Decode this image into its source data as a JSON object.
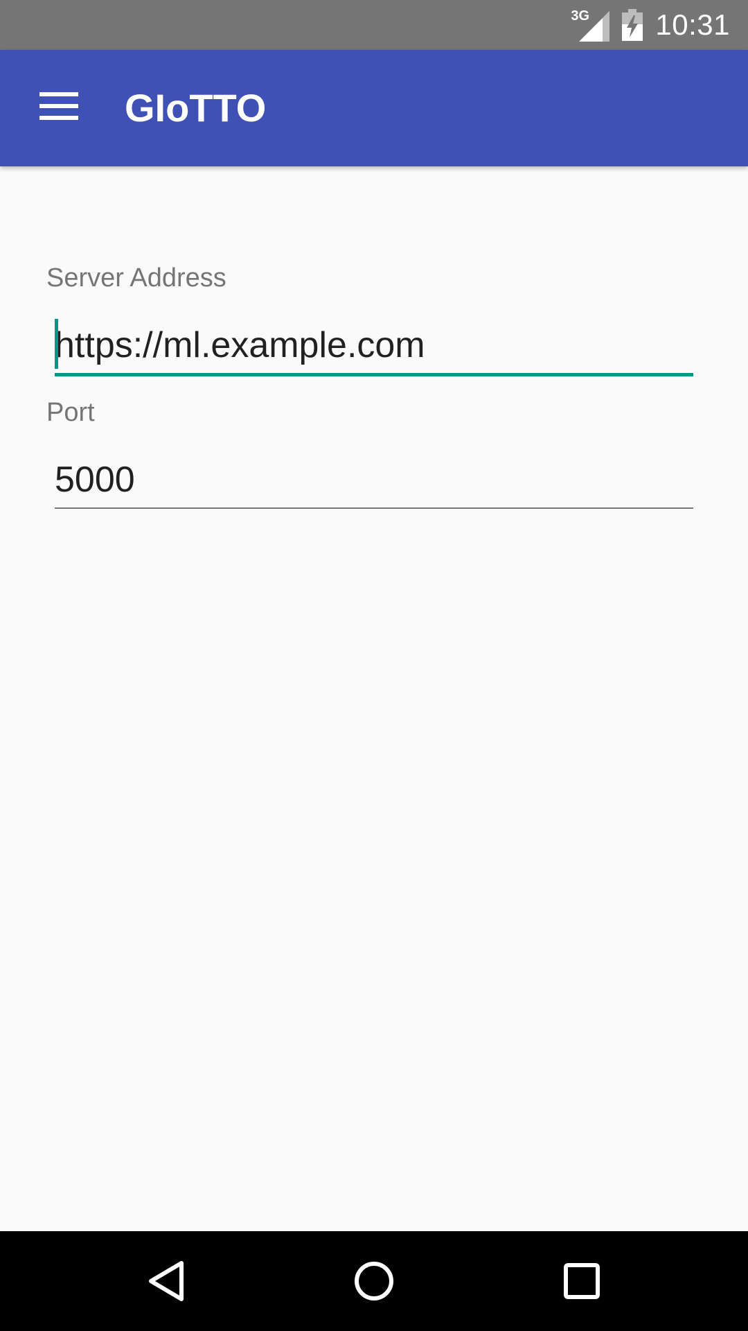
{
  "status_bar": {
    "network_type": "3G",
    "time": "10:31",
    "icons": [
      "signal-icon",
      "battery-charging-icon"
    ]
  },
  "app_bar": {
    "title": "GIoTTO",
    "menu_icon": "hamburger-menu-icon",
    "color": "#3f51b5"
  },
  "form": {
    "server_address": {
      "label": "Server Address",
      "value": "https://ml.example.com",
      "focused": true
    },
    "port": {
      "label": "Port",
      "value": "5000",
      "focused": false
    },
    "accent_color": "#009688"
  },
  "nav_bar": {
    "buttons": [
      "back-icon",
      "home-icon",
      "recents-icon"
    ]
  }
}
